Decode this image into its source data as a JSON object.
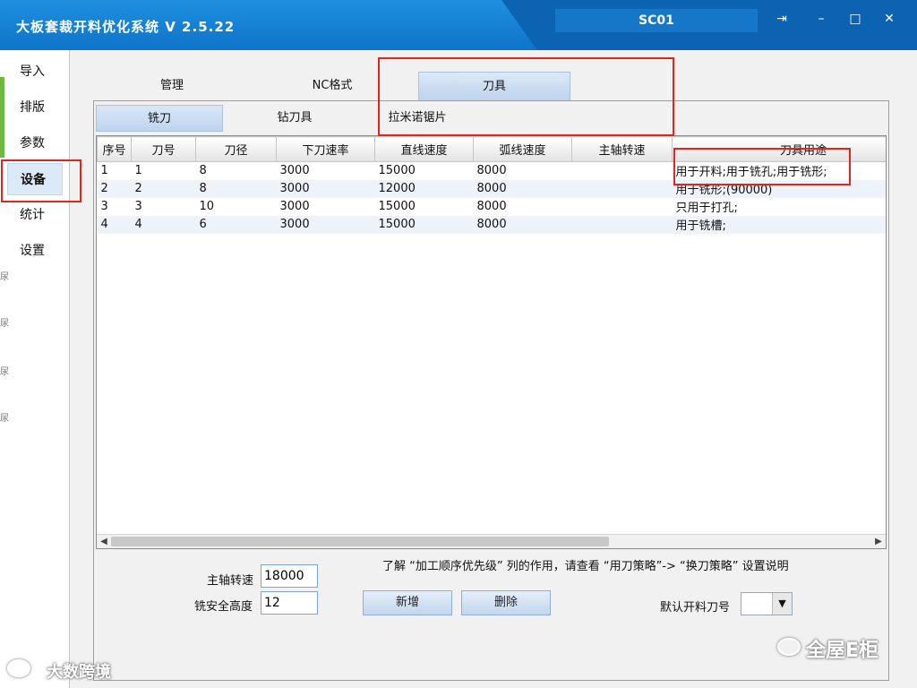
{
  "window": {
    "title": "大板套裁开料优化系统 V 2.5.22",
    "account": "SC01",
    "buttons": {
      "exit": "⇥",
      "minimize": "–",
      "maximize": "□",
      "close": "✕"
    }
  },
  "sidebar": {
    "items": [
      {
        "label": "导入"
      },
      {
        "label": "排版"
      },
      {
        "label": "参数"
      },
      {
        "label": "设备",
        "active": true
      },
      {
        "label": "统计"
      },
      {
        "label": "设置"
      }
    ],
    "edge_marks": [
      "尿",
      "尿",
      "尿",
      "尿"
    ]
  },
  "main_tabs": [
    {
      "label": "管理"
    },
    {
      "label": "NC格式"
    },
    {
      "label": "刀具",
      "active": true
    }
  ],
  "tool_tabs": [
    {
      "label": "铣刀",
      "active": true
    },
    {
      "label": "钻刀具"
    },
    {
      "label": "拉米诺锯片"
    }
  ],
  "table": {
    "columns": [
      "序号",
      "刀号",
      "刀径",
      "下刀速率",
      "直线速度",
      "弧线速度",
      "主轴转速",
      "刀具用途"
    ],
    "rows": [
      [
        "1",
        "1",
        "8",
        "3000",
        "15000",
        "8000",
        "",
        "用于开料;用于铣孔;用于铣形;"
      ],
      [
        "2",
        "2",
        "8",
        "3000",
        "12000",
        "8000",
        "",
        "用于铣形;(90000)"
      ],
      [
        "3",
        "3",
        "10",
        "3000",
        "15000",
        "8000",
        "",
        "只用于打孔;"
      ],
      [
        "4",
        "4",
        "6",
        "3000",
        "15000",
        "8000",
        "",
        "用于铣槽;"
      ]
    ]
  },
  "footer": {
    "note": "了解 “加工顺序优先级” 列的作用，请查看 “用刀策略”-> “换刀策略” 设置说明",
    "spindle_label": "主轴转速",
    "spindle_value": "18000",
    "safe_height_label": "铣安全高度",
    "safe_height_value": "12",
    "add_button": "新增",
    "delete_button": "删除",
    "default_tool_label": "默认开料刀号",
    "default_tool_value": ""
  },
  "watermarks": {
    "left": "大数跨境",
    "right": "全屋E柜"
  },
  "colors": {
    "titlebar": "#0e74c8",
    "accent_tab": "#bed3ed",
    "highlight_box": "#e1251b",
    "sidebar_strip": "#6fb844"
  }
}
